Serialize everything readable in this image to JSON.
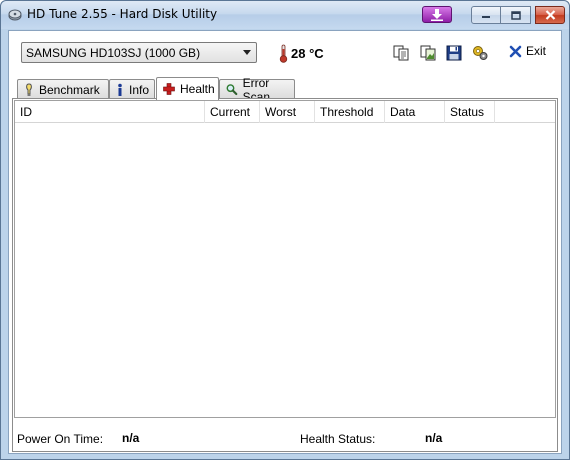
{
  "window": {
    "title": "HD Tune 2.55 - Hard Disk Utility"
  },
  "toolbar": {
    "drive": "SAMSUNG HD103SJ (1000 GB)",
    "temperature": "28 °C",
    "exit_label": "Exit"
  },
  "tabs": [
    {
      "label": "Benchmark",
      "icon": "benchmark-icon"
    },
    {
      "label": "Info",
      "icon": "info-icon"
    },
    {
      "label": "Health",
      "icon": "health-cross-icon",
      "active": true
    },
    {
      "label": "Error Scan",
      "icon": "magnifier-icon"
    }
  ],
  "table": {
    "columns": [
      "ID",
      "Current",
      "Worst",
      "Threshold",
      "Data",
      "Status"
    ],
    "rows": []
  },
  "footer": {
    "power_on_label": "Power On Time:",
    "power_on_value": "n/a",
    "health_label": "Health Status:",
    "health_value": "n/a"
  },
  "colors": {
    "titlebar": "#c7d9ee",
    "download_button": "#a13cbf",
    "close_button": "#c23a1f",
    "thermometer": "#c0392b",
    "health_cross": "#c81e1e"
  }
}
